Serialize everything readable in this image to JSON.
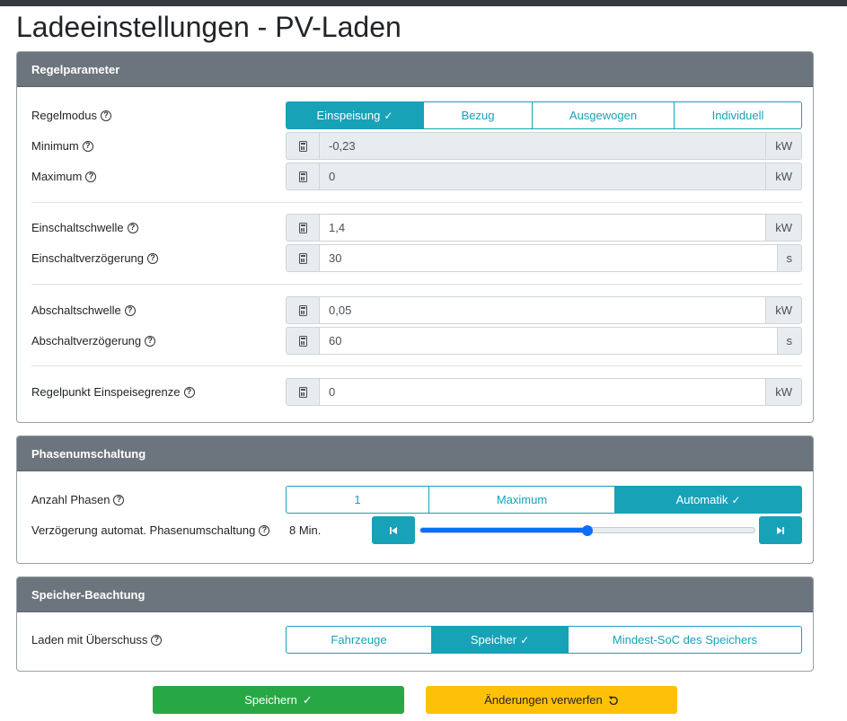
{
  "page": {
    "title": "Ladeeinstellungen - PV-Laden"
  },
  "regelparameter": {
    "header": "Regelparameter",
    "regelmodus": {
      "label": "Regelmodus",
      "options": [
        "Einspeisung",
        "Bezug",
        "Ausgewogen",
        "Individuell"
      ],
      "selected": "Einspeisung"
    },
    "minimum": {
      "label": "Minimum",
      "value": "-0,23",
      "unit": "kW"
    },
    "maximum": {
      "label": "Maximum",
      "value": "0",
      "unit": "kW"
    },
    "einschaltschwelle": {
      "label": "Einschaltschwelle",
      "value": "1,4",
      "unit": "kW"
    },
    "einschaltverzoegerung": {
      "label": "Einschaltverzögerung",
      "value": "30",
      "unit": "s"
    },
    "abschaltschwelle": {
      "label": "Abschaltschwelle",
      "value": "0,05",
      "unit": "kW"
    },
    "abschaltverzoegerung": {
      "label": "Abschaltverzögerung",
      "value": "60",
      "unit": "s"
    },
    "regelpunkt": {
      "label": "Regelpunkt Einspeisegrenze",
      "value": "0",
      "unit": "kW"
    }
  },
  "phasenumschaltung": {
    "header": "Phasenumschaltung",
    "anzahl_phasen": {
      "label": "Anzahl Phasen",
      "options": [
        "1",
        "Maximum",
        "Automatik"
      ],
      "selected": "Automatik"
    },
    "verzoegerung": {
      "label": "Verzögerung automat. Phasenumschaltung",
      "value_text": "8 Min.",
      "slider_fraction": 0.5
    }
  },
  "speicher": {
    "header": "Speicher-Beachtung",
    "laden_mit_ueberschuss": {
      "label": "Laden mit Überschuss",
      "options": [
        "Fahrzeuge",
        "Speicher",
        "Mindest-SoC des Speichers"
      ],
      "selected": "Speicher"
    }
  },
  "footer": {
    "save_label": "Speichern",
    "discard_label": "Änderungen verwerfen"
  },
  "colors": {
    "header_bg": "#6c757d",
    "accent": "#17a2b8",
    "slider": "#0d6efd",
    "save": "#28a745",
    "discard": "#ffc107"
  },
  "icons": {
    "help": "question-circle-icon",
    "input_prefix": "calculator-icon",
    "selected_mark": "check-icon",
    "slider_decrease": "step-backward-icon",
    "slider_increase": "step-forward-icon",
    "discard": "undo-icon"
  }
}
